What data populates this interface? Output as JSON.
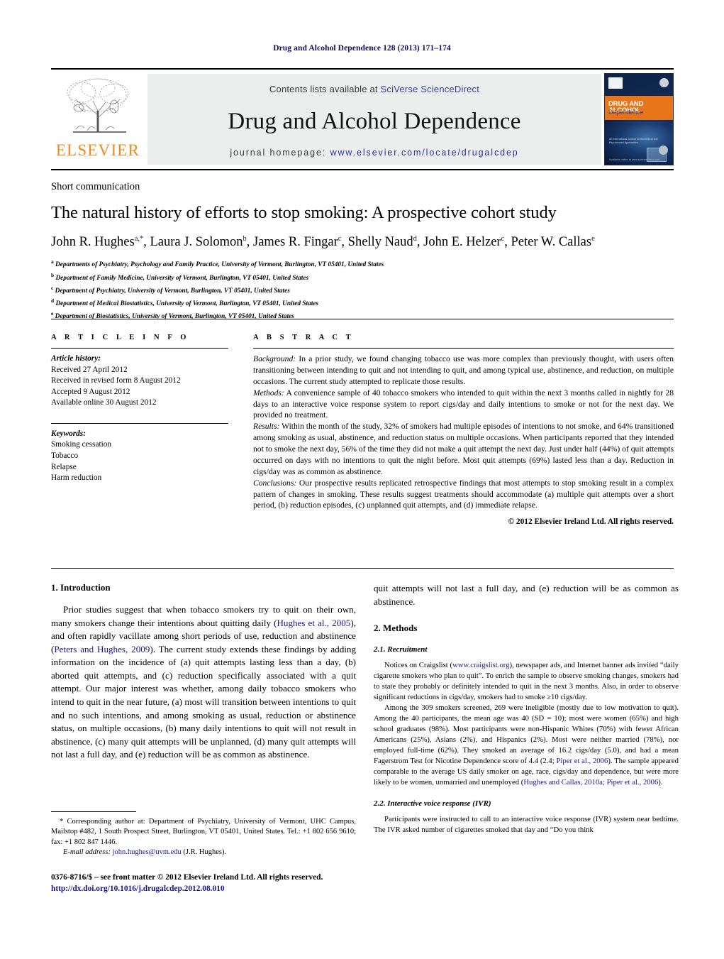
{
  "running_head": "Drug and Alcohol Dependence 128 (2013) 171–174",
  "masthead": {
    "contents_prefix": "Contents lists available at ",
    "sciencedirect_link": "SciVerse ScienceDirect",
    "journal_title": "Drug and Alcohol Dependence",
    "homepage_prefix": "journal homepage:",
    "homepage_url": "www.elsevier.com/locate/drugalcdep",
    "publisher_wordmark": "ELSEVIER",
    "cover": {
      "title_line1": "DRUG AND ALCOHOL",
      "title_line2": "Dependence",
      "caption": "An International Journal on Biomedical\nand Psychosocial Approaches",
      "footer": "Available online at www.sciencedirect.com"
    }
  },
  "article": {
    "type": "Short communication",
    "title": "The natural history of efforts to stop smoking: A prospective cohort study",
    "authors_html": "John R. Hughes<sup>a,*</sup>, Laura J. Solomon<sup>b</sup>, James R. Fingar<sup>c</sup>, Shelly Naud<sup>d</sup>, John E. Helzer<sup>c</sup>, Peter W. Callas<sup>e</sup>",
    "affiliations": [
      {
        "label": "a",
        "text": "Departments of Psychiatry, Psychology and Family Practice, University of Vermont, Burlington, VT 05401, United States"
      },
      {
        "label": "b",
        "text": "Department of Family Medicine, University of Vermont, Burlington, VT 05401, United States"
      },
      {
        "label": "c",
        "text": "Department of Psychiatry, University of Vermont, Burlington, VT 05401, United States"
      },
      {
        "label": "d",
        "text": "Department of Medical Biostatistics, University of Vermont, Burlington, VT 05401, United States"
      },
      {
        "label": "e",
        "text": "Department of Biostatistics, University of Vermont, Burlington, VT 05401, United States"
      }
    ]
  },
  "article_info": {
    "heading": "A R T I C L E   I N F O",
    "history_label": "Article history:",
    "history": [
      "Received 27 April 2012",
      "Received in revised form 8 August 2012",
      "Accepted 9 August 2012",
      "Available online 30 August 2012"
    ],
    "keywords_label": "Keywords:",
    "keywords": [
      "Smoking cessation",
      "Tobacco",
      "Relapse",
      "Harm reduction"
    ]
  },
  "abstract": {
    "heading": "A B S T R A C T",
    "background_label": "Background:",
    "background_text": " In a prior study, we found changing tobacco use was more complex than previously thought, with users often transitioning between intending to quit and not intending to quit, and among typical use, abstinence, and reduction, on multiple occasions. The current study attempted to replicate those results.",
    "methods_label": "Methods:",
    "methods_text": " A convenience sample of 40 tobacco smokers who intended to quit within the next 3 months called in nightly for 28 days to an interactive voice response system to report cigs/day and daily intentions to smoke or not for the next day. We provided no treatment.",
    "results_label": "Results:",
    "results_text": " Within the month of the study, 32% of smokers had multiple episodes of intentions to not smoke, and 64% transitioned among smoking as usual, abstinence, and reduction status on multiple occasions. When participants reported that they intended not to smoke the next day, 56% of the time they did not make a quit attempt the next day. Just under half (44%) of quit attempts occurred on days with no intentions to quit the night before. Most quit attempts (69%) lasted less than a day. Reduction in cigs/day was as common as abstinence.",
    "conclusions_label": "Conclusions:",
    "conclusions_text": " Our prospective results replicated retrospective findings that most attempts to stop smoking result in a complex pattern of changes in smoking. These results suggest treatments should accommodate (a) multiple quit attempts over a short period, (b) reduction episodes, (c) unplanned quit attempts, and (d) immediate relapse.",
    "copyright": "© 2012 Elsevier Ireland Ltd. All rights reserved."
  },
  "body": {
    "intro_heading": "1.  Introduction",
    "intro_p1_a": "Prior studies suggest that when tobacco smokers try to quit on their own, many smokers change their intentions about quitting daily (",
    "intro_cite1": "Hughes et al., 2005",
    "intro_p1_b": "), and often rapidly vacillate among short periods of use, reduction and abstinence (",
    "intro_cite2": "Peters and Hughes, 2009",
    "intro_p1_c": "). The current study extends these findings by adding information on the incidence of (a) quit attempts lasting less than a day, (b) aborted quit attempts, and (c) reduction specifically associated with a quit attempt. Our major interest was whether, among daily tobacco smokers who intend to quit in the near future, (a) most will transition between intentions to quit and no such intentions, and among smoking as usual, reduction or abstinence status, on multiple occasions, (b) many daily intentions to quit will not result in abstinence, (c) many quit attempts will be unplanned, (d) many quit attempts will not last a full day, and (e) reduction will be as common as abstinence.",
    "methods_heading": "2.  Methods",
    "recruitment_heading": "2.1.   Recruitment",
    "recruit_p1_a": "Notices on Craigslist (",
    "recruit_link": "www.craigslist.org",
    "recruit_p1_b": "), newspaper ads, and Internet banner ads invited “daily cigarette smokers who plan to quit”. To enrich the sample to observe smoking changes, smokers had to state they probably or definitely intended to quit in the next 3 months. Also, in order to observe significant reductions in cigs/day, smokers had to smoke ≥10 cigs/day.",
    "recruit_p2_a": "Among the 309 smokers screened, 269 were ineligible (mostly due to low motivation to quit). Among the 40 participants, the mean age was 40 (SD = 10); most were women (65%) and high school graduates (98%). Most participants were non-Hispanic Whites (70%) with fewer African Americans (25%), Asians (2%), and Hispanics (2%). Most were neither married (78%), nor employed full-time (62%). They smoked an average of 16.2 cigs/day (5.0), and had a mean Fagerstrom Test for Nicotine Dependence score of 4.4 (2.4; ",
    "recruit_cite1": "Piper et al., 2006",
    "recruit_p2_b": "). The sample appeared comparable to the average US daily smoker on age, race, cigs/day and dependence, but were more likely to be women, unmarried and unemployed (",
    "recruit_cite2": "Hughes and Callas, 2010a; Piper et al., 2006",
    "recruit_p2_c": ").",
    "ivr_heading": "2.2.   Interactive voice response (IVR)",
    "ivr_p1": "Participants were instructed to call to an interactive voice response (IVR) system near bedtime. The IVR asked number of cigarettes smoked that day and “Do you think"
  },
  "footnote": {
    "corresponding": "* Corresponding author at: Department of Psychiatry, University of Vermont, UHC Campus, Mailstop #482, 1 South Prospect Street, Burlington, VT 05401, United States. Tel.: +1 802 656 9610; fax: +1 802 847 1446.",
    "email_label": "E-mail address:",
    "email": "john.hughes@uvm.edu",
    "email_suffix": " (J.R. Hughes)."
  },
  "imprint": {
    "issn_line": "0376-8716/$ – see front matter © 2012 Elsevier Ireland Ltd. All rights reserved.",
    "doi": "http://dx.doi.org/10.1016/j.drugalcdep.2012.08.010"
  },
  "colors": {
    "link": "#16168c",
    "runhead": "#0d0d5c",
    "elsevier_orange": "#f08a1c",
    "masthead_gray": "#eceded"
  }
}
